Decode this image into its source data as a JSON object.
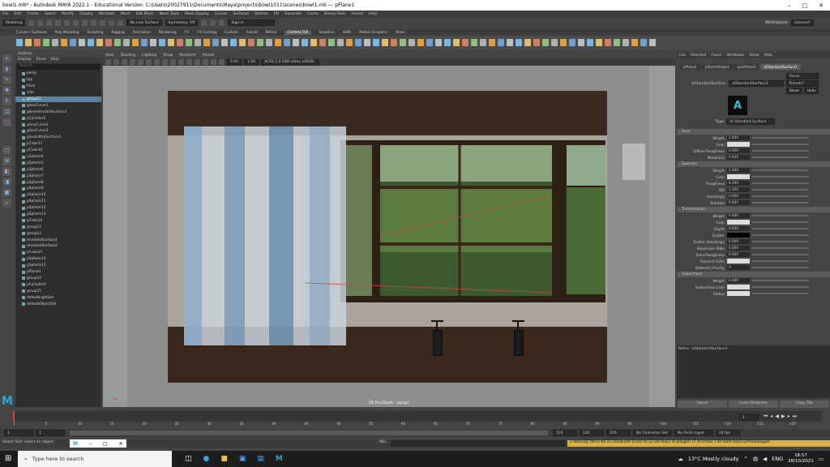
{
  "title": "bowl1.mb* - Autodesk MAYA 2022.1 - Educational Version: C:\\Users\\20027911\\Documents\\Maya\\projects\\bowl1011\\scenes\\bowl1.mb --- pPlane1",
  "menus": [
    "File",
    "Edit",
    "Create",
    "Select",
    "Modify",
    "Display",
    "Windows",
    "Mesh",
    "Edit Mesh",
    "Mesh Tools",
    "Mesh Display",
    "Curves",
    "Surfaces",
    "Deform",
    "UV",
    "Generate",
    "Cache",
    "Bonus Tools",
    "Arnold",
    "Help"
  ],
  "workspace": {
    "label": "Workspace:",
    "value": "General*"
  },
  "status": {
    "mode": "Modeling",
    "live": "No Live Surface",
    "symmetry": "Symmetry: Off",
    "signin": "Sign In"
  },
  "shelf_tabs": [
    "Curves / Surfaces",
    "Poly Modeling",
    "Sculpting",
    "Rigging",
    "Animation",
    "Rendering",
    "FX",
    "FX Caching",
    "Custom",
    "Arnold",
    "Bifrost",
    "CHARACTER",
    "Deadline",
    "HAIR",
    "Motion Graphics",
    "XGen"
  ],
  "shelf_active": "CHARACTER",
  "outliner": {
    "title": "Outliner",
    "menu": [
      "Display",
      "Show",
      "Help"
    ],
    "search": "Search...",
    "items": [
      "persp",
      "top",
      "front",
      "side",
      "group11",
      "glassCurve1",
      "glassextrudedSurface1",
      "pCylinder6",
      "glassCurve2",
      "glassCurve3",
      "glassloftedSurface1",
      "pCube17",
      "pCube16",
      "pSphere4",
      "pSphere5",
      "pSphere6",
      "pSphere7",
      "pSphere8",
      "pSphere9",
      "pSphere10",
      "pSphere11",
      "pSphere12",
      "pSphere13",
      "pCube19",
      "group12",
      "group13",
      "revolvedSurface1",
      "revolvedSurface2",
      "pCube21",
      "pSphere14",
      "pSphere15",
      "pPlane3",
      "group14",
      "pCylinder9",
      "group15",
      "defaultLightSet",
      "defaultObjectSet"
    ],
    "selected": "group11"
  },
  "viewport": {
    "menu": [
      "View",
      "Shading",
      "Lighting",
      "Show",
      "Renderer",
      "Panels"
    ],
    "colorspace": "ACES 1.0 SDR-video (sRGB)",
    "val1": "0.00",
    "val2": "1.00",
    "label": "2D Pan/Zoom : persp1"
  },
  "attr": {
    "tabs": [
      "List",
      "Selected",
      "Focus",
      "Attributes",
      "Show",
      "Help"
    ],
    "nodes": [
      "pPlane1",
      "pPlaneShape1",
      "pasiPlane2",
      "aiStandardSurface1"
    ],
    "node_label": "aiStandardSurface:",
    "node_value": "aiStandardSurface1",
    "focus": "Focus",
    "presets": "Presets*",
    "show": "Show",
    "hide": "Hide",
    "type_label": "Type",
    "type_value": "Ai Standard Surface",
    "sections": [
      {
        "name": "Base",
        "rows": [
          [
            "Weight",
            "1.000"
          ],
          [
            "Color",
            ""
          ],
          [
            "Diffuse Roughness",
            "0.000"
          ],
          [
            "Metalness",
            "0.000"
          ]
        ]
      },
      {
        "name": "Specular",
        "rows": [
          [
            "Weight",
            "1.000"
          ],
          [
            "Color",
            ""
          ],
          [
            "Roughness",
            "0.200"
          ],
          [
            "IOR",
            "1.000"
          ],
          [
            "Anisotropy",
            "0.000"
          ],
          [
            "Rotation",
            "0.000"
          ]
        ]
      },
      {
        "name": "Transmission",
        "rows": [
          [
            "Weight",
            "0.000"
          ],
          [
            "Color",
            ""
          ],
          [
            "Depth",
            "0.000"
          ],
          [
            "Scatter",
            ""
          ],
          [
            "Scatter Anisotropy",
            "0.000"
          ],
          [
            "Dispersion Abbe",
            "0.000"
          ],
          [
            "Extra Roughness",
            "0.000"
          ],
          [
            "Transmit AOVs",
            ""
          ],
          [
            "Dielectric Priority",
            "0"
          ]
        ]
      },
      {
        "name": "Subsurface",
        "rows": [
          [
            "Weight",
            "0.000"
          ],
          [
            "Subsurface Color",
            ""
          ],
          [
            "Radius",
            ""
          ]
        ]
      }
    ],
    "notes": "Notes: aiStandardSurface1",
    "buttons": [
      "Select",
      "Load Attributes",
      "Copy Tab"
    ]
  },
  "time": {
    "ticks": [
      "1",
      "5",
      "10",
      "15",
      "20",
      "25",
      "30",
      "35",
      "40",
      "45",
      "50",
      "55",
      "60",
      "65",
      "70",
      "75",
      "80",
      "85",
      "90",
      "95",
      "100",
      "105",
      "110",
      "115",
      "120"
    ],
    "current": "1"
  },
  "range": {
    "start": "1",
    "start2": "1",
    "end": "120",
    "end2": "120",
    "end3": "200",
    "fps": "24 fps",
    "charset": "No Character Set",
    "anim": "No Anim Layer"
  },
  "cmd": {
    "label": "MEL",
    "warning": "// Warning: (Mrsi) No uv coordinate exists for uv set map1 at polygon 77 at vertex 1 on mesh bowl1:pPlaneShape4."
  },
  "help": "Select Tool: select an object",
  "taskbar": {
    "search": "Type here to search",
    "weather": "13°C  Mostly cloudy",
    "time": "18:57",
    "date": "28/10/2021"
  }
}
